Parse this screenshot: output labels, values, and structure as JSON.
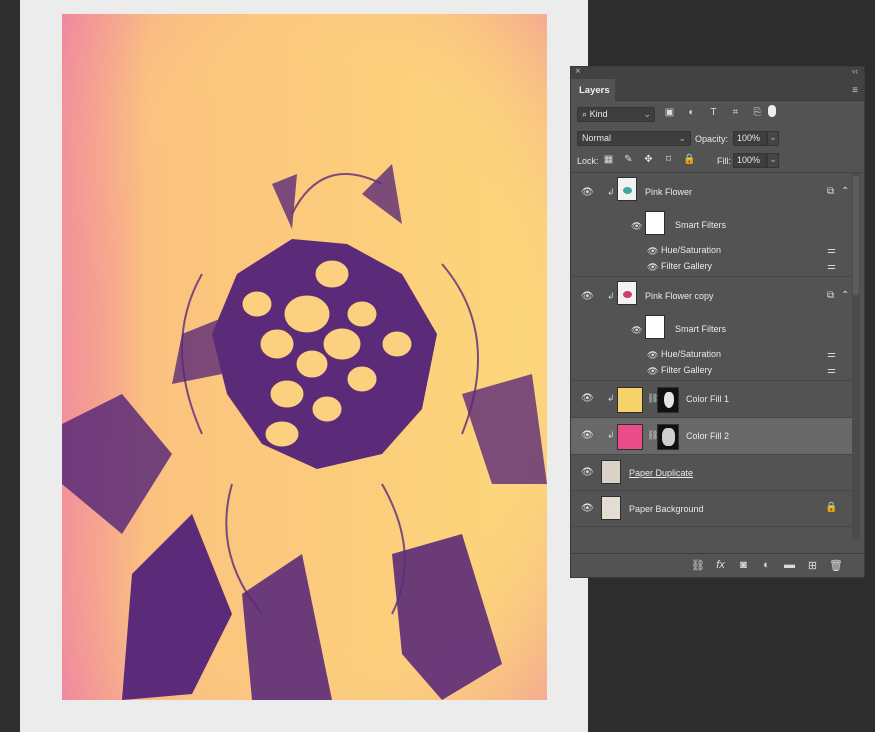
{
  "panel": {
    "close_glyph": "×",
    "collapse_glyph": "‹‹",
    "tab_label": "Layers",
    "menu_icon": "panel-menu-icon"
  },
  "filter": {
    "kind_label": "Kind",
    "icons": [
      "pixel-filter-icon",
      "adjustment-filter-icon",
      "type-filter-icon",
      "shape-filter-icon",
      "smartobject-filter-icon"
    ]
  },
  "blend": {
    "mode": "Normal",
    "opacity_label": "Opacity:",
    "opacity_value": "100%"
  },
  "lock": {
    "label": "Lock:",
    "fill_label": "Fill:",
    "fill_value": "100%"
  },
  "layers": [
    {
      "name": "Pink Flower",
      "type": "smart-object",
      "filters_label": "Smart Filters",
      "filters": [
        "Hue/Saturation",
        "Filter Gallery"
      ]
    },
    {
      "name": "Pink Flower copy",
      "type": "smart-object",
      "filters_label": "Smart Filters",
      "filters": [
        "Hue/Saturation",
        "Filter Gallery"
      ]
    },
    {
      "name": "Color Fill 1",
      "type": "fill",
      "color": "#f5d36a"
    },
    {
      "name": "Color Fill 2",
      "type": "fill",
      "color": "#e94c86",
      "selected": true
    },
    {
      "name": "Paper Duplicate",
      "type": "image"
    },
    {
      "name": "Paper Background",
      "type": "background",
      "locked": true
    }
  ],
  "bottom_icons": [
    "link-icon",
    "fx-icon",
    "mask-icon",
    "adjustment-icon",
    "folder-icon",
    "new-layer-icon",
    "trash-icon"
  ],
  "colors": {
    "artwork_yellow": "#fcd77a",
    "artwork_purple": "#5b2a78",
    "artwork_pink": "#f29aa6",
    "panel_bg": "#535353",
    "selected_row": "#686868"
  }
}
